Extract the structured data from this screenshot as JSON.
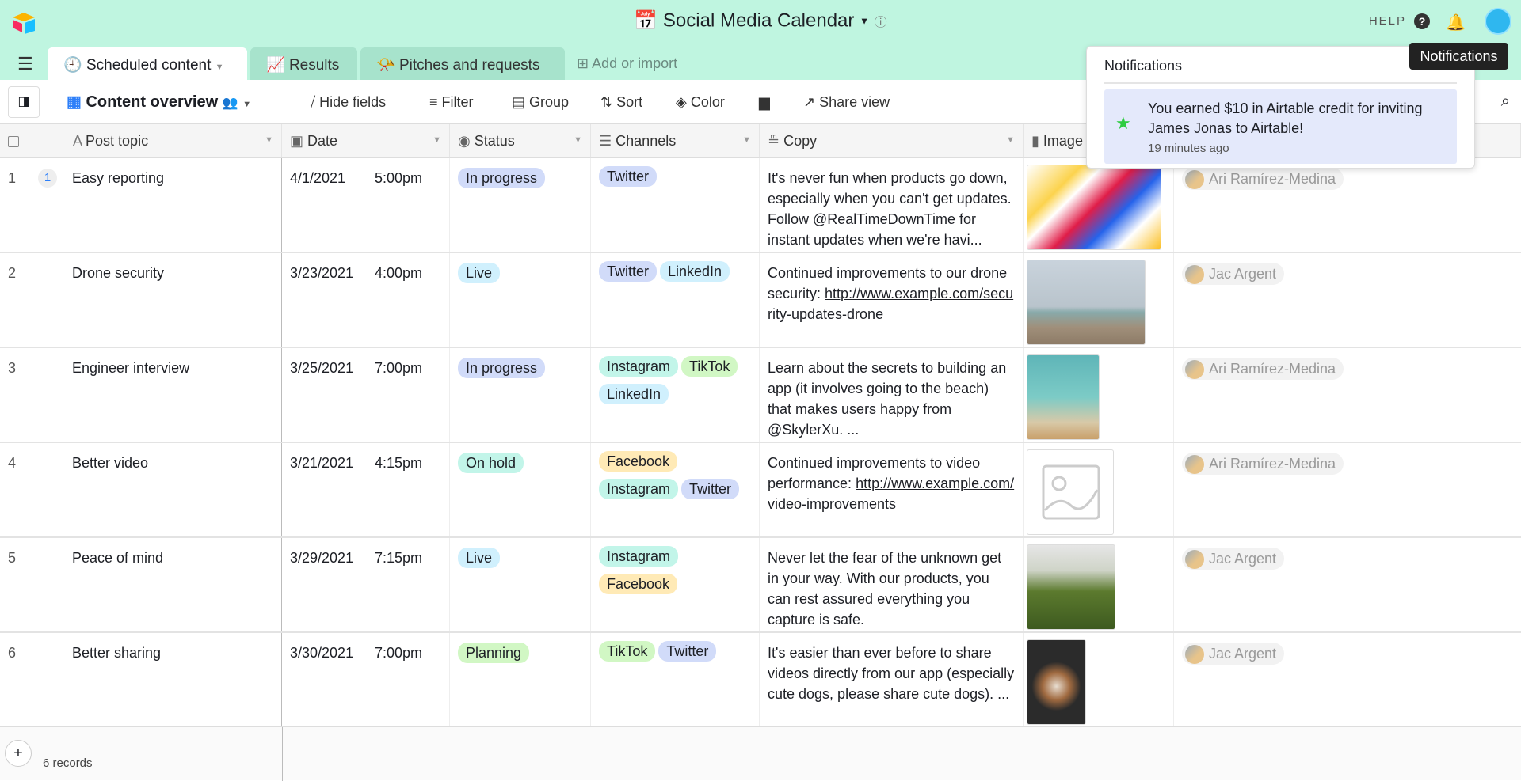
{
  "app": {
    "title": "Social Media Calendar",
    "help": "HELP"
  },
  "tabs": [
    {
      "label": "Scheduled content",
      "icon": "clock-icon",
      "active": true
    },
    {
      "label": "Results",
      "icon": "chart-icon"
    },
    {
      "label": "Pitches and requests",
      "icon": "megaphone-icon"
    }
  ],
  "add_import": "Add or import",
  "toolbar": {
    "view_name": "Content overview",
    "hide_fields": "Hide fields",
    "filter": "Filter",
    "group": "Group",
    "sort": "Sort",
    "color": "Color",
    "share_view": "Share view"
  },
  "columns": [
    "Post topic",
    "Date",
    "Status",
    "Channels",
    "Copy",
    "Image"
  ],
  "pill_colors": {
    "In progress": "#d1dbf9",
    "Live": "#d0f0fd",
    "On hold": "#c2f5e9",
    "Planning": "#d1f7c4",
    "Twitter": "#d1dbf9",
    "LinkedIn": "#d0f0fd",
    "Instagram": "#c2f5e9",
    "TikTok": "#d1f7c4",
    "Facebook": "#ffeab6"
  },
  "rows": [
    {
      "num": "1",
      "comments": "1",
      "topic": "Easy reporting",
      "date": "4/1/2021",
      "time": "5:00pm",
      "status": "In progress",
      "channels": [
        "Twitter"
      ],
      "copy": "It's never fun when products go down, especially when you can't get updates. Follow @RealTimeDownTime for instant updates when we're havi...",
      "link": "",
      "image": "illustration",
      "person": "Ari Ramírez-Medina"
    },
    {
      "num": "2",
      "topic": "Drone security",
      "date": "3/23/2021",
      "time": "4:00pm",
      "status": "Live",
      "channels": [
        "Twitter",
        "LinkedIn"
      ],
      "copy": "Continued improvements to our drone security:",
      "link": "http://www.example.com/security-updates-drone",
      "image": "drone",
      "person": "Jac Argent"
    },
    {
      "num": "3",
      "topic": "Engineer interview",
      "date": "3/25/2021",
      "time": "7:00pm",
      "status": "In progress",
      "channels": [
        "Instagram",
        "TikTok",
        "LinkedIn"
      ],
      "copy": "Learn about the secrets to building an app (it involves going to the beach) that makes users happy from @SkylerXu. ...",
      "link": "",
      "image": "beach",
      "person": "Ari Ramírez-Medina"
    },
    {
      "num": "4",
      "topic": "Better video",
      "date": "3/21/2021",
      "time": "4:15pm",
      "status": "On hold",
      "channels": [
        "Facebook",
        "Instagram",
        "Twitter"
      ],
      "copy": "Continued improvements to video performance:",
      "link": "http://www.example.com/video-improvements",
      "image": "placeholder",
      "person": "Ari Ramírez-Medina"
    },
    {
      "num": "5",
      "topic": "Peace of mind",
      "date": "3/29/2021",
      "time": "7:15pm",
      "status": "Live",
      "channels": [
        "Instagram",
        "Facebook"
      ],
      "copy": "Never let the fear of the unknown get in your way. With our products, you can rest assured everything you capture is safe.",
      "link": "",
      "image": "bicycle",
      "person": "Jac Argent"
    },
    {
      "num": "6",
      "topic": "Better sharing",
      "date": "3/30/2021",
      "time": "7:00pm",
      "status": "Planning",
      "channels": [
        "TikTok",
        "Twitter"
      ],
      "copy": "It's easier than ever before to share videos directly from our app (especially cute dogs, please share cute dogs). ...",
      "link": "",
      "image": "dog",
      "person": "Jac Argent"
    }
  ],
  "footer": {
    "records": "6 records"
  },
  "notifications": {
    "title": "Notifications",
    "message": "You earned $10 in Airtable credit for inviting James Jonas to Airtable!",
    "time": "19 minutes ago"
  },
  "tooltip": "Notifications"
}
